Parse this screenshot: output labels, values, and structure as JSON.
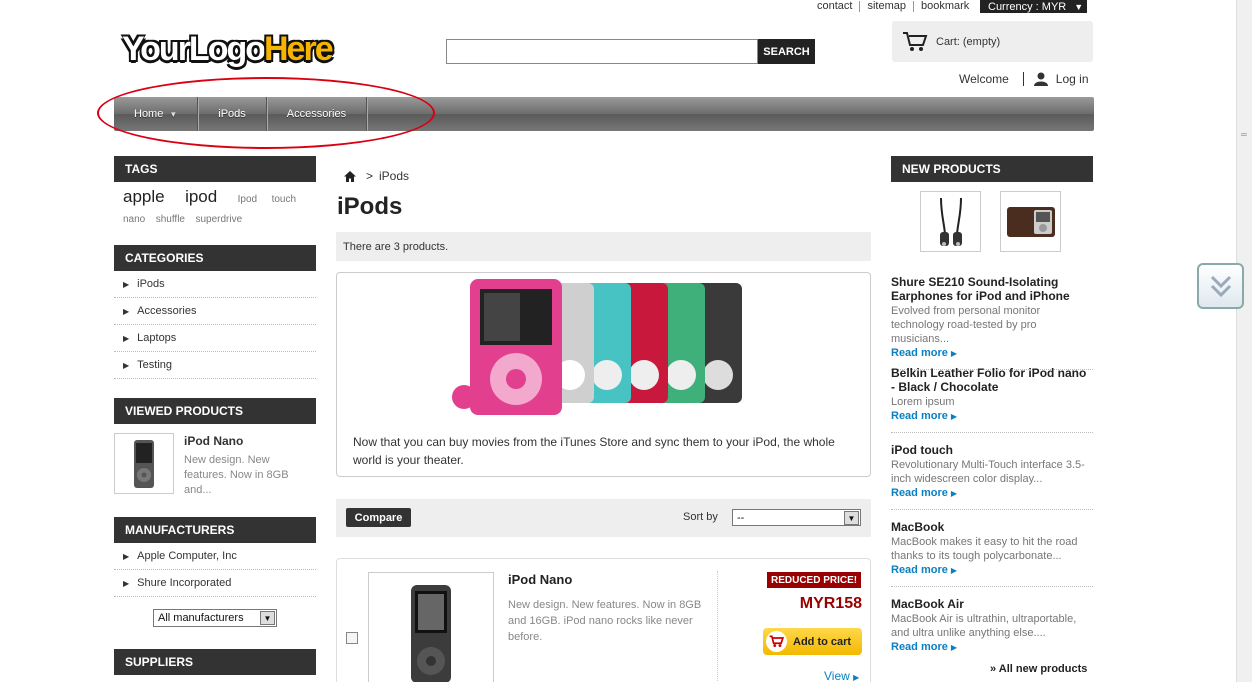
{
  "header": {
    "top_links": [
      "contact",
      "sitemap",
      "bookmark"
    ],
    "currency_label": "Currency : MYR",
    "logo_part1": "YourLogo",
    "logo_part2": "Here",
    "search_placeholder": "",
    "search_button": "SEARCH",
    "cart_label": "Cart: (empty)",
    "welcome": "Welcome",
    "login": "Log in"
  },
  "menu": {
    "items": [
      "Home",
      "iPods",
      "Accessories"
    ]
  },
  "left": {
    "tags_title": "TAGS",
    "tags_big": [
      "apple",
      "ipod"
    ],
    "tags_small": [
      "Ipod",
      "touch",
      "nano",
      "shuffle",
      "superdrive"
    ],
    "categories_title": "CATEGORIES",
    "categories": [
      "iPods",
      "Accessories",
      "Laptops",
      "Testing"
    ],
    "viewed_title": "VIEWED PRODUCTS",
    "viewed_name": "iPod Nano",
    "viewed_desc": "New design. New features. Now in 8GB and...",
    "manufacturers_title": "MANUFACTURERS",
    "manufacturers": [
      "Apple Computer, Inc",
      "Shure Incorporated"
    ],
    "manufacturers_select": "All manufacturers",
    "suppliers_title": "SUPPLIERS"
  },
  "center": {
    "breadcrumb_sep": ">",
    "breadcrumb_current": "iPods",
    "title": "iPods",
    "count_text": "There are 3 products.",
    "description": "Now that you can buy movies from the iTunes Store and sync them to your iPod, the whole world is your theater.",
    "compare_button": "Compare",
    "sort_label": "Sort by",
    "sort_value": "--",
    "product": {
      "name": "iPod Nano",
      "description": "New design. New features. Now in 8GB and 16GB. iPod nano rocks like never before.",
      "badge": "REDUCED PRICE!",
      "price": "MYR158",
      "add_to_cart": "Add to cart",
      "view": "View"
    }
  },
  "right": {
    "new_products_title": "NEW PRODUCTS",
    "items": [
      {
        "title": "Shure SE210 Sound-Isolating Earphones for iPod and iPhone",
        "desc": "Evolved from personal monitor technology road-tested by pro musicians...",
        "more": "Read more"
      },
      {
        "title": "Belkin Leather Folio for iPod nano - Black / Chocolate",
        "desc": "Lorem ipsum",
        "more": "Read more"
      },
      {
        "title": "iPod touch",
        "desc": "Revolutionary Multi-Touch interface 3.5-inch widescreen color display...",
        "more": "Read more"
      },
      {
        "title": "MacBook",
        "desc": "MacBook makes it easy to hit the road thanks to its tough polycarbonate...",
        "more": "Read more"
      },
      {
        "title": "MacBook Air",
        "desc": "MacBook Air is ultrathin, ultraportable, and ultra unlike anything else....",
        "more": "Read more"
      }
    ],
    "all_new": "» All new products"
  },
  "colors": {
    "accent_blue": "#0a7fc1",
    "price_red": "#990000",
    "annotation_red": "#d90012",
    "dark_block": "#333333",
    "cart_yellow": "#f3b800"
  }
}
